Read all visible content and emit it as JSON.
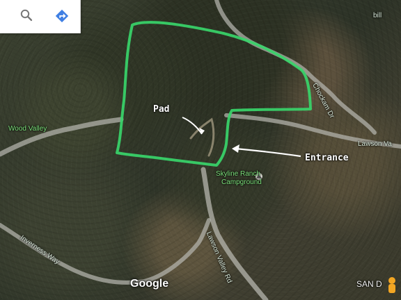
{
  "map": {
    "place_labels": {
      "wood_valley": "Wood Valley",
      "lawson_valley_road": "Lawson Va",
      "chockam_dr": "Chockam Dr",
      "skyline_ranch_campground_line1": "Skyline Ranch",
      "skyline_ranch_campground_line2": "Campground",
      "inverness_way": "Inverness Way",
      "lawson_valley_rd": "Lawson Valley Rd",
      "top_right_label": "bill"
    },
    "annotations": {
      "pad": "Pad",
      "entrance": "Entrance"
    },
    "branding": {
      "google": "Google",
      "watermark": "SAN D"
    },
    "icons": {
      "search": "search-icon",
      "directions": "directions-icon",
      "campground": "campground-icon",
      "pegman": "pegman-icon"
    },
    "colors": {
      "property_outline": "#38d56a",
      "annotation_arrow": "#ffffff",
      "road": "#b6b6ae"
    }
  }
}
